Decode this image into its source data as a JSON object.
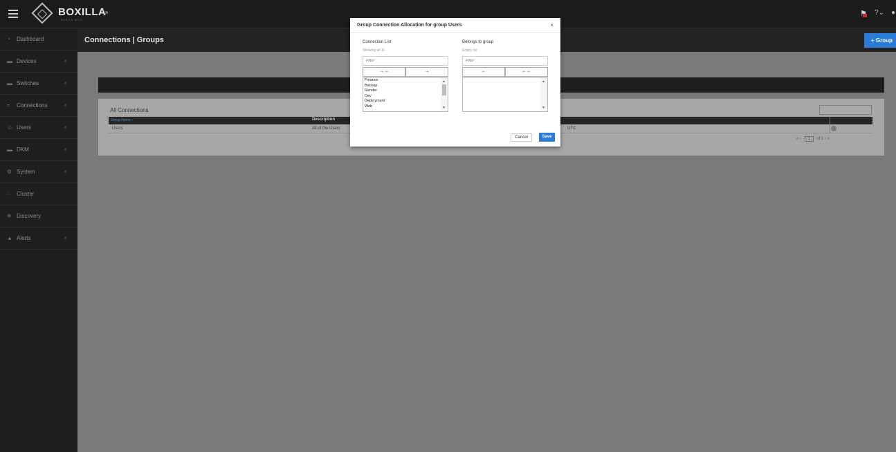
{
  "topbar": {
    "logo": "BOXILLA",
    "logo_sub": "BLACK BOX",
    "external_link_icon": "external-link-icon",
    "help_label": "?",
    "help_caret": "⌄"
  },
  "sidebar": {
    "items": [
      {
        "label": "Dashboard",
        "icon": "dashboard-icon"
      },
      {
        "label": "Devices",
        "icon": "devices-icon"
      },
      {
        "label": "Switches",
        "icon": "switches-icon"
      },
      {
        "label": "Connections",
        "icon": "connections-icon"
      },
      {
        "label": "Users",
        "icon": "users-icon"
      },
      {
        "label": "DKM",
        "icon": "dkm-icon"
      },
      {
        "label": "System",
        "icon": "gear-icon"
      },
      {
        "label": "Cluster",
        "icon": "cluster-icon"
      },
      {
        "label": "Discovery",
        "icon": "discovery-icon"
      },
      {
        "label": "Alerts",
        "icon": "alert-icon"
      }
    ]
  },
  "header": {
    "title": "Connections | Groups",
    "add_button": "+ Group"
  },
  "panel": {
    "title": "All Connections",
    "columns": [
      "Group Name ↑",
      "Description"
    ],
    "rows": [
      {
        "name": "Users",
        "description": "All of the Users",
        "extra": "UTC"
      }
    ],
    "pager": {
      "first": "«",
      "prev": "‹",
      "page": "1",
      "of": "of 1",
      "next": "›",
      "last": "»"
    }
  },
  "modal": {
    "title": "Group Connection Allocation for group Users",
    "close": "×",
    "left": {
      "label": "Connection List",
      "sub": "Showing all 11",
      "filter_placeholder": "Filter",
      "btn_move_all": "→→",
      "btn_move": "→",
      "items": [
        "Finance",
        "Backup",
        "Render",
        "Dev",
        "Deployment",
        "Web"
      ]
    },
    "right": {
      "label": "Belongs to group",
      "sub": "Empty list",
      "filter_placeholder": "Filter",
      "btn_remove": "←",
      "btn_remove_all": "←←"
    },
    "cancel": "Cancel",
    "save": "Save"
  }
}
